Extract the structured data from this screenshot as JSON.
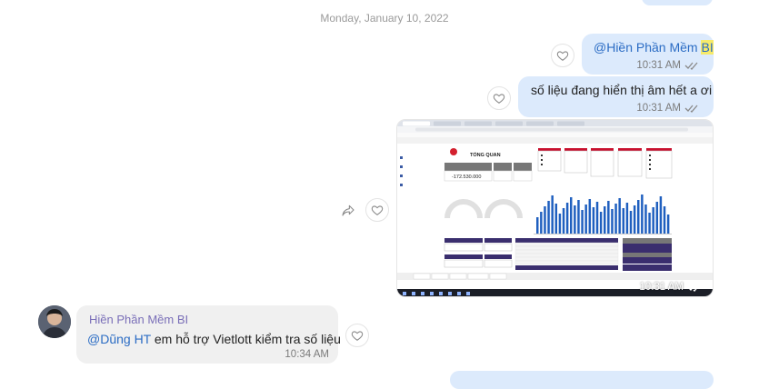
{
  "date_separator": "Monday, January 10, 2022",
  "messages": [
    {
      "mention": "@Hiền Phần Mềm ",
      "mention_highlight": "BI",
      "time": "10:31 AM"
    },
    {
      "text": "số liệu đang hiển thị âm hết a ơi",
      "time": "10:31 AM"
    },
    {
      "image_alt": "Power BI dashboard screenshot",
      "dashboard_title": "TỔNG QUAN",
      "dashboard_kpi": "-172.530.000",
      "time": "10:31 AM"
    },
    {
      "sender": "Hiền Phần Mềm BI",
      "mention": "@Dũng HT",
      "text": " em hỗ trợ Vietlott kiểm tra số liệu",
      "time": "10:34 AM"
    }
  ],
  "icons": {
    "react": "heart-outline-icon",
    "share": "share-forward-icon",
    "read": "double-check-icon"
  },
  "colors": {
    "outgoing_bubble": "#dceafc",
    "incoming_bubble": "#f0f0f0",
    "mention": "#2b6cc4",
    "sender_name": "#7a6fb8"
  }
}
